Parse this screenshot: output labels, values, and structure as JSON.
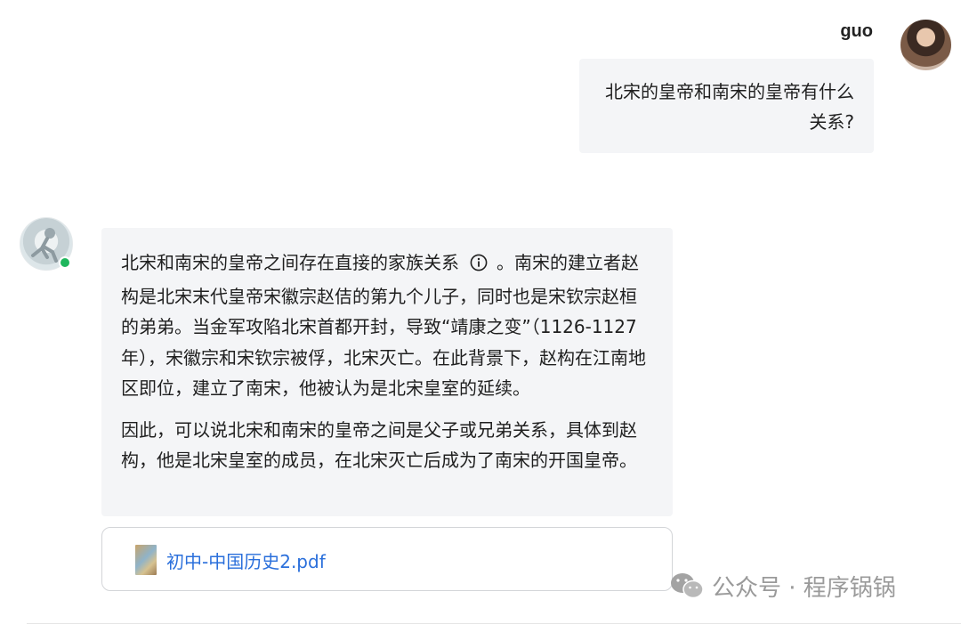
{
  "user": {
    "name": "guo",
    "message": "北宋的皇帝和南宋的皇帝有什么关系?"
  },
  "assistant": {
    "paragraph1_before_icon": "北宋和南宋的皇帝之间存在直接的家族关系",
    "paragraph1_after_icon": "。南宋的建立者赵构是北宋末代皇帝宋徽宗赵佶的第九个儿子，同时也是宋钦宗赵桓的弟弟。当金军攻陷北宋首都开封，导致“靖康之变”（1126-1127年），宋徽宗和宋钦宗被俘，北宋灭亡。在此背景下，赵构在江南地区即位，建立了南宋，他被认为是北宋皇室的延续。",
    "paragraph2": "因此，可以说北宋和南宋的皇帝之间是父子或兄弟关系，具体到赵构，他是北宋皇室的成员，在北宋灭亡后成为了南宋的开国皇帝。",
    "info_icon": "info-circle-icon",
    "status": "online",
    "status_color": "#1fb65d"
  },
  "attachment": {
    "file_name": "初中-中国历史2.pdf",
    "icon": "pdf-thumbnail-icon"
  },
  "watermark": {
    "text": "公众号 · 程序锅锅",
    "icon": "wechat-icon"
  },
  "colors": {
    "bubble_bg": "#f4f5f7",
    "link": "#2a6fdb",
    "text": "#1f1f1f"
  }
}
